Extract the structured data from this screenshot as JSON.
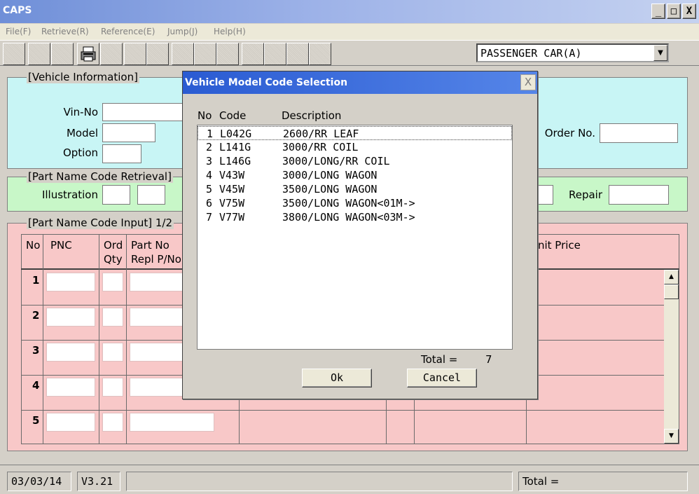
{
  "window": {
    "title": "CAPS",
    "minimize": "_",
    "maximize": "□",
    "close": "X"
  },
  "menu": [
    "File(F)",
    "Retrieve(R)",
    "Reference(E)",
    "Jump(J)",
    "Help(H)"
  ],
  "vehicle_type": {
    "selected": "PASSENGER CAR(A)"
  },
  "vehicle_info": {
    "legend": "[Vehicle Information]",
    "vin_label": "Vin-No",
    "model_label": "Model",
    "option_label": "Option",
    "order_label": "Order No."
  },
  "part_name_retrieval": {
    "legend": "[Part Name Code Retrieval]",
    "illustration_label": "Illustration",
    "repair_label": "Repair"
  },
  "part_input": {
    "legend": "[Part Name Code Input] 1/2",
    "headers": {
      "no": "No",
      "pnc": "PNC",
      "ord": "Ord",
      "qty": "Qty",
      "partno": "Part No",
      "repl": "Repl P/No",
      "unit_price": "Unit Price"
    },
    "rows": [
      "1",
      "2",
      "3",
      "4",
      "5"
    ]
  },
  "status": {
    "date": "03/03/14",
    "version": "V3.21",
    "total_label": "Total ="
  },
  "dialog": {
    "title": "Vehicle Model Code Selection",
    "close": "X",
    "headers": {
      "no": "No",
      "code": "Code",
      "description": "Description"
    },
    "rows": [
      {
        "no": "1",
        "code": "L042G",
        "description": "2600/RR LEAF"
      },
      {
        "no": "2",
        "code": "L141G",
        "description": "3000/RR COIL"
      },
      {
        "no": "3",
        "code": "L146G",
        "description": "3000/LONG/RR COIL"
      },
      {
        "no": "4",
        "code": "V43W",
        "description": "3000/LONG WAGON"
      },
      {
        "no": "5",
        "code": "V45W",
        "description": "3500/LONG WAGON"
      },
      {
        "no": "6",
        "code": "V75W",
        "description": "3500/LONG WAGON<01M->"
      },
      {
        "no": "7",
        "code": "V77W",
        "description": "3800/LONG WAGON<03M->"
      }
    ],
    "total_label": "Total =",
    "total_value": "7",
    "ok_label": "Ok",
    "cancel_label": "Cancel"
  }
}
